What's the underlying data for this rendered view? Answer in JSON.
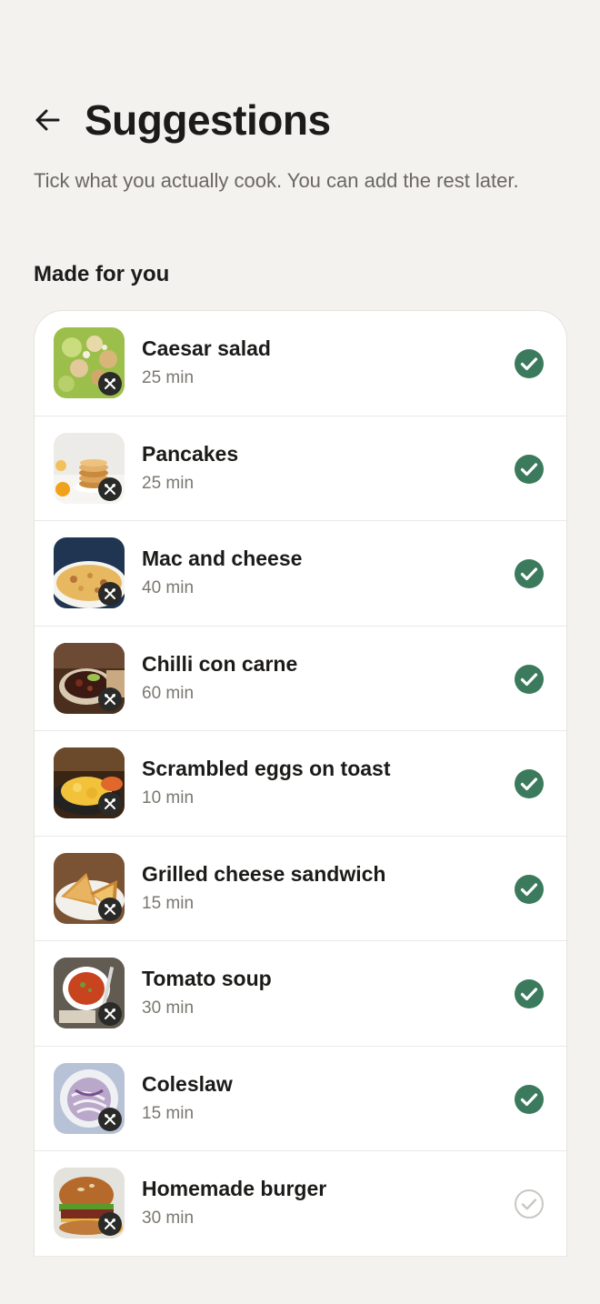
{
  "header": {
    "title": "Suggestions",
    "back_icon": "arrow-left-icon"
  },
  "subtitle": "Tick what you actually cook. You can add the rest later.",
  "section_label": "Made for you",
  "colors": {
    "background": "#f3f2ef",
    "checked": "#3b7a5c",
    "unchecked": "#c9c7c2"
  },
  "recipes": [
    {
      "name": "Caesar salad",
      "time": "25 min",
      "checked": true,
      "image": "caesar-salad"
    },
    {
      "name": "Pancakes",
      "time": "25 min",
      "checked": true,
      "image": "pancakes"
    },
    {
      "name": "Mac and cheese",
      "time": "40 min",
      "checked": true,
      "image": "mac-and-cheese"
    },
    {
      "name": "Chilli con carne",
      "time": "60 min",
      "checked": true,
      "image": "chilli-con-carne"
    },
    {
      "name": "Scrambled eggs on toast",
      "time": "10 min",
      "checked": true,
      "image": "scrambled-eggs"
    },
    {
      "name": "Grilled cheese sandwich",
      "time": "15 min",
      "checked": true,
      "image": "grilled-cheese"
    },
    {
      "name": "Tomato soup",
      "time": "30 min",
      "checked": true,
      "image": "tomato-soup"
    },
    {
      "name": "Coleslaw",
      "time": "15 min",
      "checked": true,
      "image": "coleslaw"
    },
    {
      "name": "Homemade burger",
      "time": "30 min",
      "checked": false,
      "image": "burger"
    }
  ]
}
